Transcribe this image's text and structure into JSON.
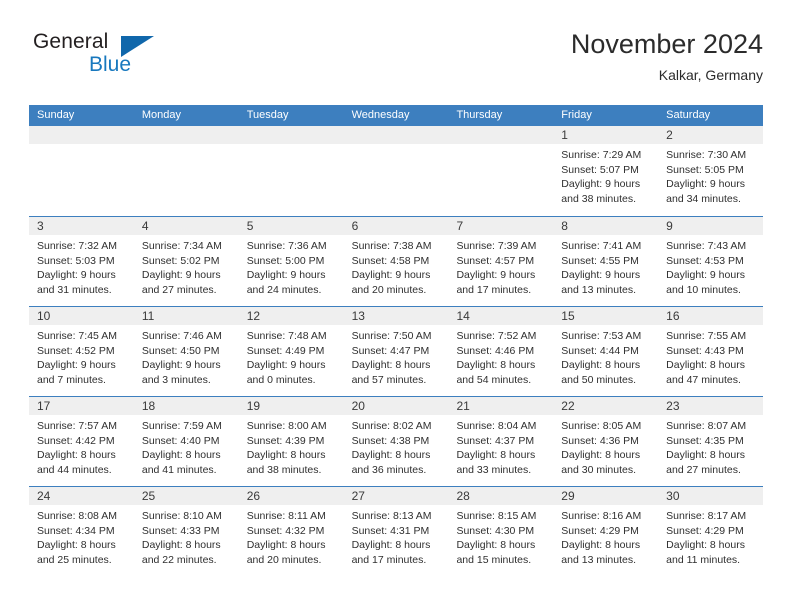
{
  "brand": {
    "name_part1": "General",
    "name_part2": "Blue",
    "logo_icon": "triangle-logo-icon"
  },
  "header": {
    "title": "November 2024",
    "subtitle": "Kalkar, Germany"
  },
  "colors": {
    "header_blue": "#3d7fbf",
    "brand_blue": "#1878be",
    "logo_blue": "#1067ab",
    "day_band": "#efefef"
  },
  "weekdays": [
    "Sunday",
    "Monday",
    "Tuesday",
    "Wednesday",
    "Thursday",
    "Friday",
    "Saturday"
  ],
  "weeks": [
    [
      {
        "day": "",
        "empty": true
      },
      {
        "day": "",
        "empty": true
      },
      {
        "day": "",
        "empty": true
      },
      {
        "day": "",
        "empty": true
      },
      {
        "day": "",
        "empty": true
      },
      {
        "day": "1",
        "sunrise": "Sunrise: 7:29 AM",
        "sunset": "Sunset: 5:07 PM",
        "daylight1": "Daylight: 9 hours",
        "daylight2": "and 38 minutes."
      },
      {
        "day": "2",
        "sunrise": "Sunrise: 7:30 AM",
        "sunset": "Sunset: 5:05 PM",
        "daylight1": "Daylight: 9 hours",
        "daylight2": "and 34 minutes."
      }
    ],
    [
      {
        "day": "3",
        "sunrise": "Sunrise: 7:32 AM",
        "sunset": "Sunset: 5:03 PM",
        "daylight1": "Daylight: 9 hours",
        "daylight2": "and 31 minutes."
      },
      {
        "day": "4",
        "sunrise": "Sunrise: 7:34 AM",
        "sunset": "Sunset: 5:02 PM",
        "daylight1": "Daylight: 9 hours",
        "daylight2": "and 27 minutes."
      },
      {
        "day": "5",
        "sunrise": "Sunrise: 7:36 AM",
        "sunset": "Sunset: 5:00 PM",
        "daylight1": "Daylight: 9 hours",
        "daylight2": "and 24 minutes."
      },
      {
        "day": "6",
        "sunrise": "Sunrise: 7:38 AM",
        "sunset": "Sunset: 4:58 PM",
        "daylight1": "Daylight: 9 hours",
        "daylight2": "and 20 minutes."
      },
      {
        "day": "7",
        "sunrise": "Sunrise: 7:39 AM",
        "sunset": "Sunset: 4:57 PM",
        "daylight1": "Daylight: 9 hours",
        "daylight2": "and 17 minutes."
      },
      {
        "day": "8",
        "sunrise": "Sunrise: 7:41 AM",
        "sunset": "Sunset: 4:55 PM",
        "daylight1": "Daylight: 9 hours",
        "daylight2": "and 13 minutes."
      },
      {
        "day": "9",
        "sunrise": "Sunrise: 7:43 AM",
        "sunset": "Sunset: 4:53 PM",
        "daylight1": "Daylight: 9 hours",
        "daylight2": "and 10 minutes."
      }
    ],
    [
      {
        "day": "10",
        "sunrise": "Sunrise: 7:45 AM",
        "sunset": "Sunset: 4:52 PM",
        "daylight1": "Daylight: 9 hours",
        "daylight2": "and 7 minutes."
      },
      {
        "day": "11",
        "sunrise": "Sunrise: 7:46 AM",
        "sunset": "Sunset: 4:50 PM",
        "daylight1": "Daylight: 9 hours",
        "daylight2": "and 3 minutes."
      },
      {
        "day": "12",
        "sunrise": "Sunrise: 7:48 AM",
        "sunset": "Sunset: 4:49 PM",
        "daylight1": "Daylight: 9 hours",
        "daylight2": "and 0 minutes."
      },
      {
        "day": "13",
        "sunrise": "Sunrise: 7:50 AM",
        "sunset": "Sunset: 4:47 PM",
        "daylight1": "Daylight: 8 hours",
        "daylight2": "and 57 minutes."
      },
      {
        "day": "14",
        "sunrise": "Sunrise: 7:52 AM",
        "sunset": "Sunset: 4:46 PM",
        "daylight1": "Daylight: 8 hours",
        "daylight2": "and 54 minutes."
      },
      {
        "day": "15",
        "sunrise": "Sunrise: 7:53 AM",
        "sunset": "Sunset: 4:44 PM",
        "daylight1": "Daylight: 8 hours",
        "daylight2": "and 50 minutes."
      },
      {
        "day": "16",
        "sunrise": "Sunrise: 7:55 AM",
        "sunset": "Sunset: 4:43 PM",
        "daylight1": "Daylight: 8 hours",
        "daylight2": "and 47 minutes."
      }
    ],
    [
      {
        "day": "17",
        "sunrise": "Sunrise: 7:57 AM",
        "sunset": "Sunset: 4:42 PM",
        "daylight1": "Daylight: 8 hours",
        "daylight2": "and 44 minutes."
      },
      {
        "day": "18",
        "sunrise": "Sunrise: 7:59 AM",
        "sunset": "Sunset: 4:40 PM",
        "daylight1": "Daylight: 8 hours",
        "daylight2": "and 41 minutes."
      },
      {
        "day": "19",
        "sunrise": "Sunrise: 8:00 AM",
        "sunset": "Sunset: 4:39 PM",
        "daylight1": "Daylight: 8 hours",
        "daylight2": "and 38 minutes."
      },
      {
        "day": "20",
        "sunrise": "Sunrise: 8:02 AM",
        "sunset": "Sunset: 4:38 PM",
        "daylight1": "Daylight: 8 hours",
        "daylight2": "and 36 minutes."
      },
      {
        "day": "21",
        "sunrise": "Sunrise: 8:04 AM",
        "sunset": "Sunset: 4:37 PM",
        "daylight1": "Daylight: 8 hours",
        "daylight2": "and 33 minutes."
      },
      {
        "day": "22",
        "sunrise": "Sunrise: 8:05 AM",
        "sunset": "Sunset: 4:36 PM",
        "daylight1": "Daylight: 8 hours",
        "daylight2": "and 30 minutes."
      },
      {
        "day": "23",
        "sunrise": "Sunrise: 8:07 AM",
        "sunset": "Sunset: 4:35 PM",
        "daylight1": "Daylight: 8 hours",
        "daylight2": "and 27 minutes."
      }
    ],
    [
      {
        "day": "24",
        "sunrise": "Sunrise: 8:08 AM",
        "sunset": "Sunset: 4:34 PM",
        "daylight1": "Daylight: 8 hours",
        "daylight2": "and 25 minutes."
      },
      {
        "day": "25",
        "sunrise": "Sunrise: 8:10 AM",
        "sunset": "Sunset: 4:33 PM",
        "daylight1": "Daylight: 8 hours",
        "daylight2": "and 22 minutes."
      },
      {
        "day": "26",
        "sunrise": "Sunrise: 8:11 AM",
        "sunset": "Sunset: 4:32 PM",
        "daylight1": "Daylight: 8 hours",
        "daylight2": "and 20 minutes."
      },
      {
        "day": "27",
        "sunrise": "Sunrise: 8:13 AM",
        "sunset": "Sunset: 4:31 PM",
        "daylight1": "Daylight: 8 hours",
        "daylight2": "and 17 minutes."
      },
      {
        "day": "28",
        "sunrise": "Sunrise: 8:15 AM",
        "sunset": "Sunset: 4:30 PM",
        "daylight1": "Daylight: 8 hours",
        "daylight2": "and 15 minutes."
      },
      {
        "day": "29",
        "sunrise": "Sunrise: 8:16 AM",
        "sunset": "Sunset: 4:29 PM",
        "daylight1": "Daylight: 8 hours",
        "daylight2": "and 13 minutes."
      },
      {
        "day": "30",
        "sunrise": "Sunrise: 8:17 AM",
        "sunset": "Sunset: 4:29 PM",
        "daylight1": "Daylight: 8 hours",
        "daylight2": "and 11 minutes."
      }
    ]
  ]
}
